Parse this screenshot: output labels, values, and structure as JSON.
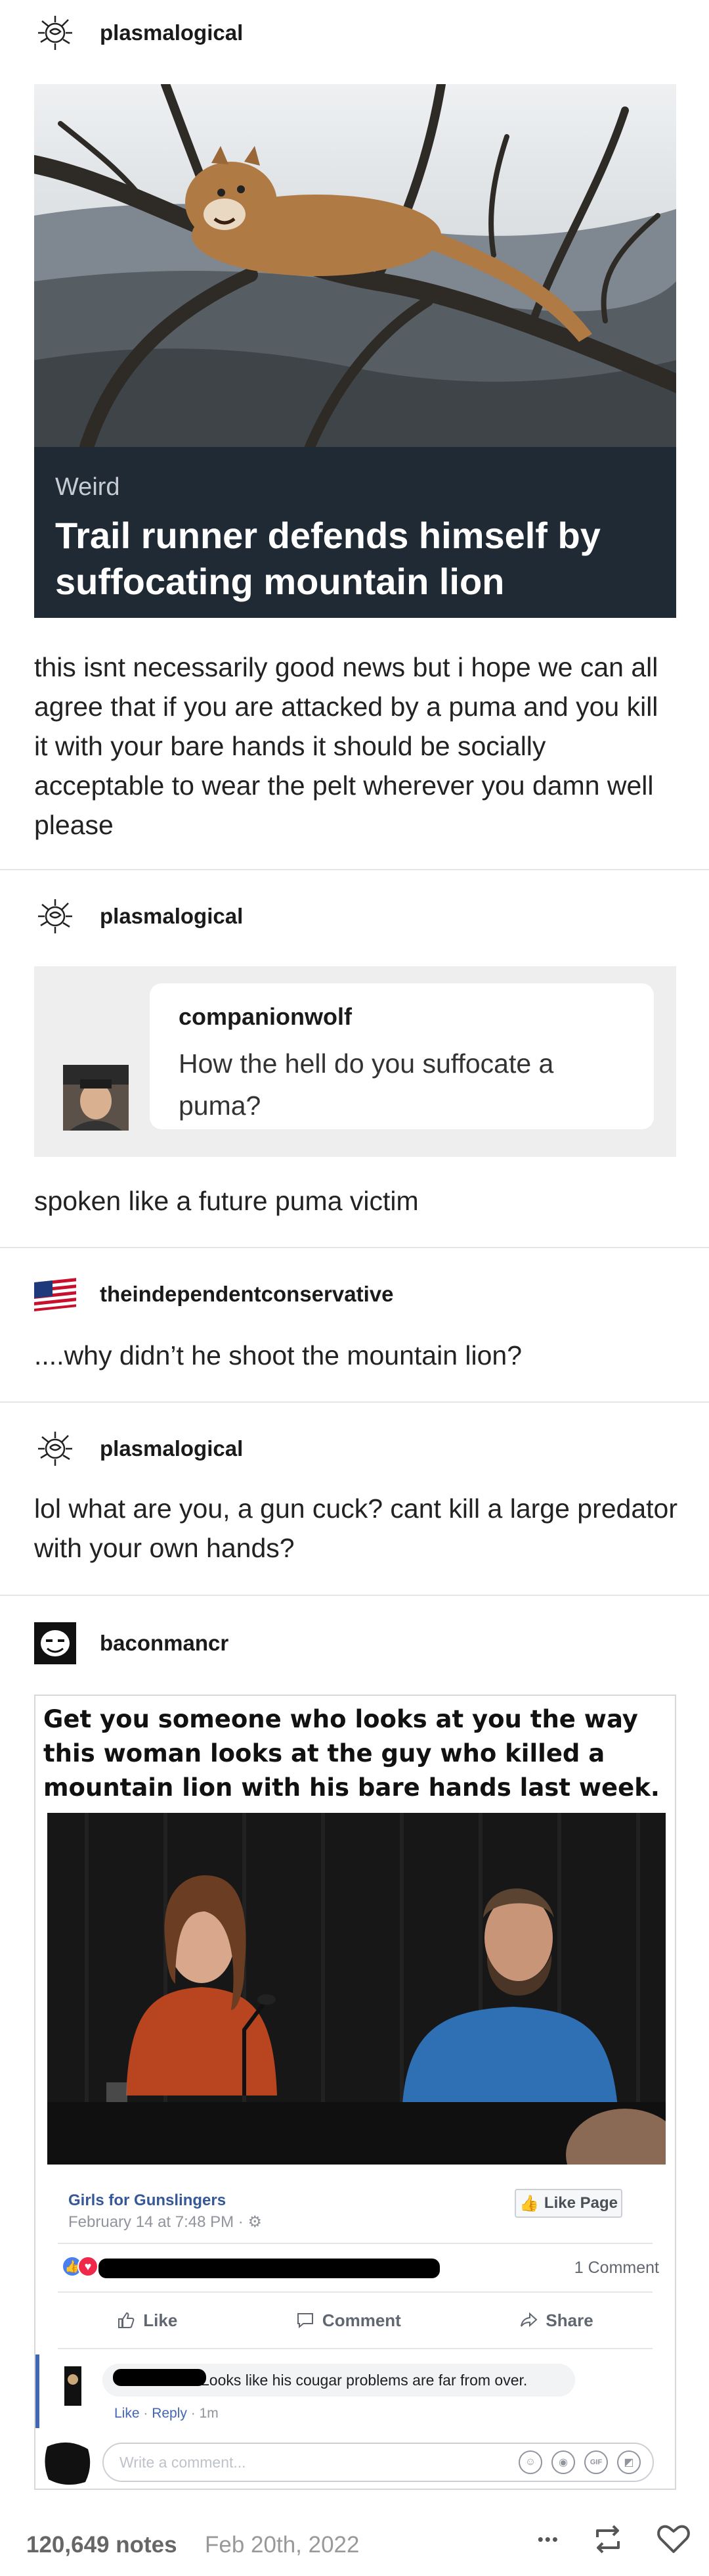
{
  "posts": [
    {
      "username": "plasmalogical",
      "article": {
        "category": "Weird",
        "title": "Trail runner defends himself by suffocating mountain lion"
      },
      "text": "this isnt necessarily good news but i hope we can all agree that if you are attacked by a puma and you kill it with your bare hands it should be socially acceptable to wear the pelt wherever you damn well please"
    },
    {
      "username": "plasmalogical",
      "quote": {
        "username": "companionwolf",
        "text": "How the hell do you suffocate a puma?"
      },
      "text": "spoken like a future puma victim"
    },
    {
      "username": "theindependentconservative",
      "text": "....why didn’t he shoot the mountain lion?"
    },
    {
      "username": "plasmalogical",
      "text": "lol what are you, a gun cuck? cant kill a large predator with your own hands?"
    },
    {
      "username": "baconmancr",
      "meme": {
        "caption": "Get you someone who looks at you the way this woman looks at the guy who killed a mountain lion with his bare hands last week.",
        "fb": {
          "page_name": "Girls for Gunslingers",
          "date": "February 14 at 7:48 PM · ",
          "like_page": "Like Page",
          "comment_count": "1 Comment",
          "actions": [
            "Like",
            "Comment",
            "Share"
          ],
          "comment_text": "Looks like his cougar problems are far from over.",
          "comment_like": "Like",
          "comment_reply": "Reply",
          "comment_time": "1m",
          "input_placeholder": "Write a comment...",
          "gif_label": "GIF"
        }
      }
    }
  ],
  "footer": {
    "notes": "120,649 notes",
    "date": "Feb 20th, 2022",
    "more": "•••"
  },
  "colors": {
    "accent_fb": "#4267b2",
    "caption_bg": "#1f2a34",
    "quote_bg": "#eeeeee"
  },
  "icons": [
    "scribble-avatar-icon",
    "flag-avatar-icon",
    "meme-face-avatar-icon",
    "more-icon",
    "reblog-icon",
    "heart-icon"
  ]
}
